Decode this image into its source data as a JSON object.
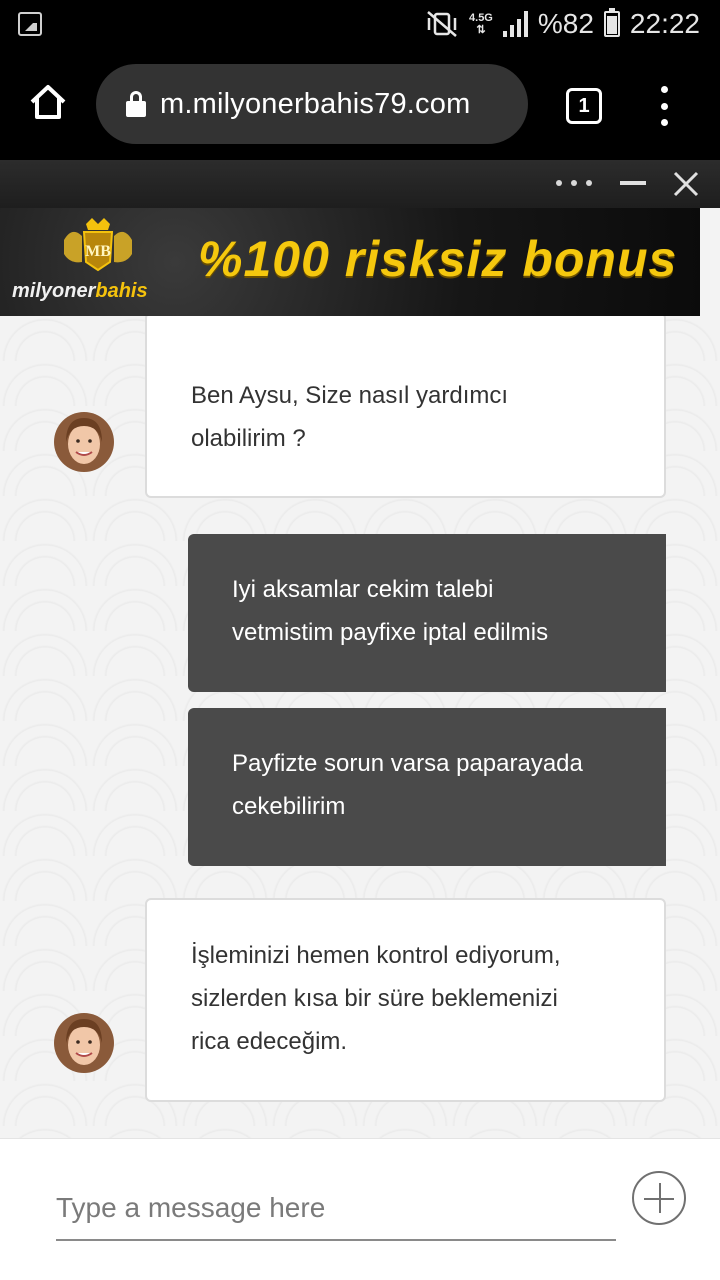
{
  "status_bar": {
    "network_type": "4.5G",
    "battery_percent": "%82",
    "battery_level": 0.82,
    "time": "22:22",
    "icons": [
      "gallery-notification-icon",
      "vibrate-mute-icon",
      "signal-icon",
      "battery-icon"
    ]
  },
  "browser": {
    "url": "m.milyonerbahis79.com",
    "tab_count": "1",
    "icons": [
      "home-icon",
      "lock-icon",
      "tabs-icon",
      "overflow-menu-icon"
    ]
  },
  "widget": {
    "icons": [
      "more-options-icon",
      "minimize-icon",
      "close-icon"
    ]
  },
  "banner": {
    "brand_prefix": "milyoner",
    "brand_suffix": "bahis",
    "crest_letters": "MB",
    "headline": "%100 risksiz bonus",
    "accent_color": "#f5c80e"
  },
  "chat": {
    "messages": [
      {
        "sender": "agent",
        "line1": "Ben Aysu, Size nasıl yardımcı",
        "line2": "olabilirim ?"
      },
      {
        "sender": "user",
        "line1": "Iyi aksamlar cekim talebi",
        "line2": "vetmistim payfixe iptal edilmis"
      },
      {
        "sender": "user",
        "line1": "Payfizte sorun varsa paparayada",
        "line2": "cekebilirim"
      },
      {
        "sender": "agent",
        "line1": "İşleminizi hemen kontrol ediyorum,",
        "line2": "sizlerden kısa bir süre beklemenizi",
        "line3": "rica edeceğim."
      }
    ],
    "user_bubble_color": "#4a4a4a",
    "agent_bubble_color": "#ffffff"
  },
  "composer": {
    "placeholder": "Type a message here",
    "value": ""
  }
}
